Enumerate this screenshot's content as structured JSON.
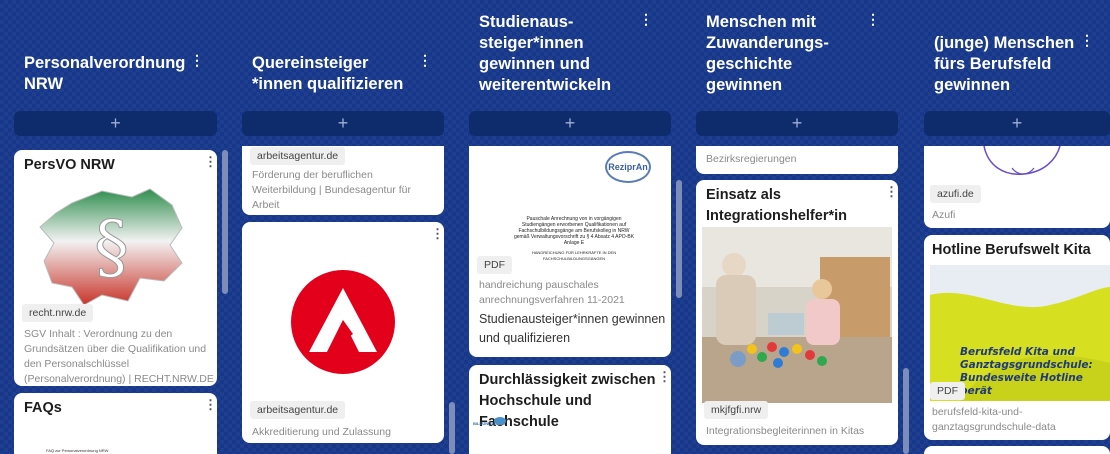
{
  "columns": [
    {
      "title_lines": [
        "Personalverordnung",
        "NRW"
      ],
      "add_label": "+",
      "cards": [
        {
          "title": "PersVO NRW",
          "source": "recht.nrw.de",
          "desc_lines": [
            "SGV Inhalt : Verordnung zu den",
            "Grundsätzen über die Qualifikation und",
            "den Personalschlüssel",
            "(Personalverordnung) | RECHT.NRW.DE"
          ]
        },
        {
          "title": "FAQs",
          "preview_text": "FAQ zur Personalverordnung NRW"
        }
      ]
    },
    {
      "title_lines": [
        "Quereinsteiger",
        "*innen qualifizieren"
      ],
      "add_label": "+",
      "cards": [
        {
          "source": "arbeitsagentur.de",
          "desc_lines": [
            "Förderung der beruflichen",
            "Weiterbildung | Bundesagentur für",
            "Arbeit"
          ]
        },
        {
          "source": "arbeitsagentur.de",
          "desc_lines": [
            "Akkreditierung und Zulassung"
          ]
        }
      ]
    },
    {
      "title_lines": [
        "Studienaus-",
        "steiger*innen",
        "gewinnen und",
        "weiterentwickeln"
      ],
      "add_label": "+",
      "cards": [
        {
          "logo_text": "ReziprAn",
          "doc_lines": [
            "Pauschale Anrechnung von in vorgängigen",
            "Studiengängen erworbenen Qualifikationen auf",
            "Fachschulbildungsgänge am Berufskolleg in NRW",
            "gemäß Verwaltungsvorschrift zu § 4 Absatz 4 APO-BK",
            "Anlage E"
          ],
          "doc_sub": [
            "HANDREICHUNG FÜR LEHRKRÄFTE IN DEN",
            "FACHSCHULBILDUNGSGÄNGEN"
          ],
          "badge": "PDF",
          "desc_lines": [
            "handreichung pauschales",
            "anrechnungsverfahren 11-2021"
          ],
          "dark_lines": [
            "Studienausteiger*innen gewinnen",
            "und qualifizieren"
          ]
        },
        {
          "title_lines": [
            "Durchlässigkeit zwischen",
            "Hochschule und Fachschule"
          ],
          "preview_logo": "BILDUNGSLAND"
        }
      ]
    },
    {
      "title_lines": [
        "Menschen mit",
        "Zuwanderungs-",
        "geschichte",
        "gewinnen"
      ],
      "add_label": "+",
      "cards": [
        {
          "desc_lines": [
            "Bezirksregierungen"
          ]
        },
        {
          "title_lines": [
            "Einsatz als",
            "Integrationshelfer*in"
          ],
          "source": "mkjfgfi.nrw",
          "desc_lines": [
            "Integrationsbegleiterinnen in Kitas"
          ]
        }
      ]
    },
    {
      "title_lines": [
        "(junge) Menschen",
        "fürs Berufsfeld",
        "gewinnen"
      ],
      "add_label": "+",
      "cards": [
        {
          "source": "azufi.de",
          "desc_lines": [
            "Azufi"
          ]
        },
        {
          "title": "Hotline Berufswelt Kita",
          "banner_lines": [
            "Berufsfeld Kita und",
            "Ganztagsgrundschule:",
            "Bundesweite Hotline berät"
          ],
          "badge": "PDF",
          "desc_lines": [
            "berufsfeld-kita-und-",
            "ganztagsgrundschule-data"
          ]
        }
      ]
    }
  ],
  "colors": {
    "background": "#17388a",
    "add_button": "#0e2b6c",
    "db_red": "#e2001a",
    "banner_yellow": "#d6df20"
  }
}
